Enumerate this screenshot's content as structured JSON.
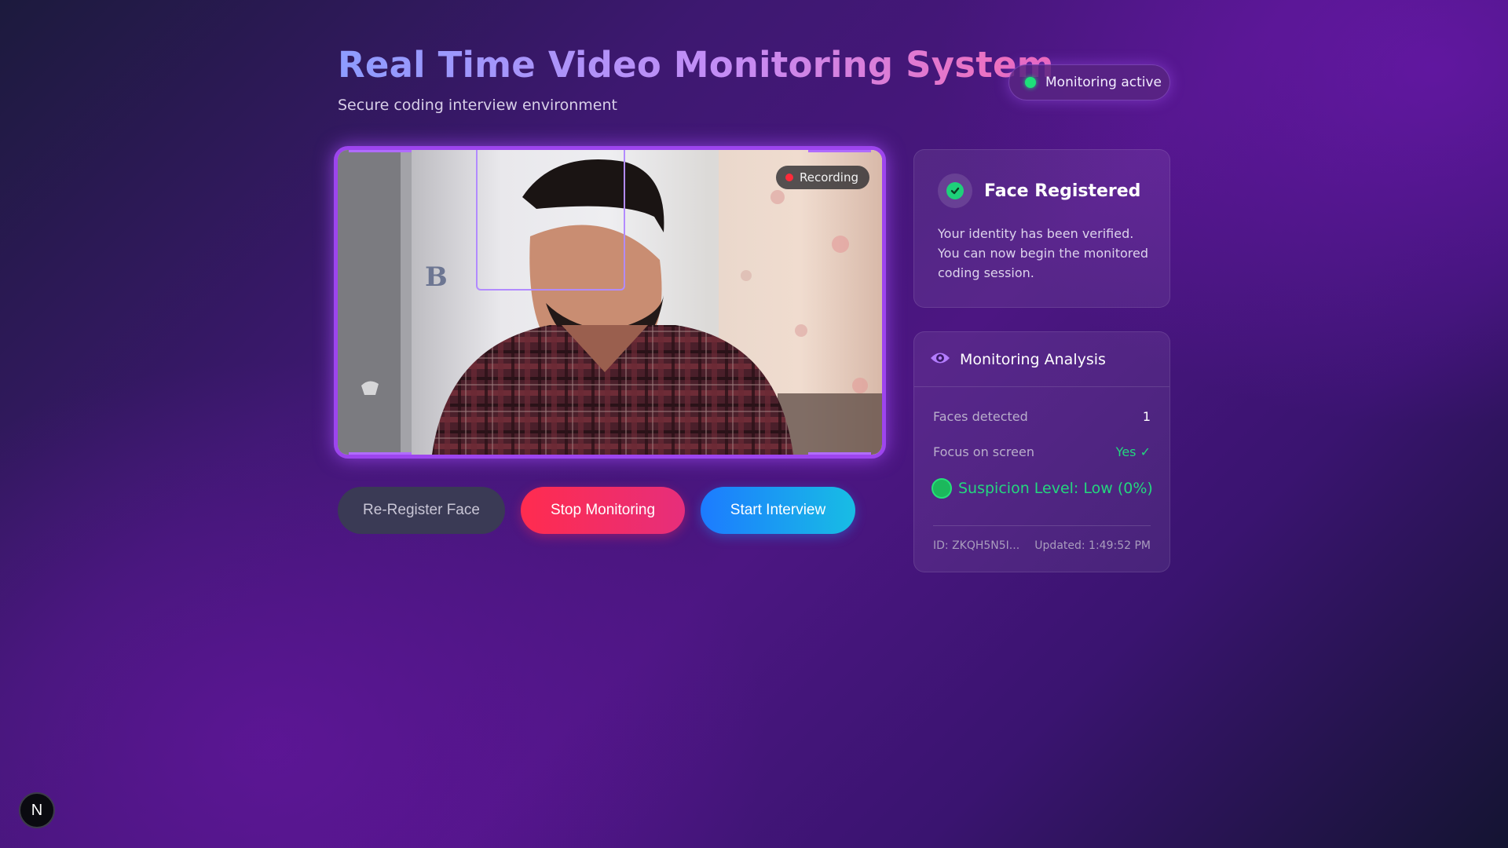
{
  "header": {
    "title": "Real Time Video Monitoring System",
    "subtitle": "Secure coding interview environment"
  },
  "status": {
    "label": "Monitoring active",
    "color": "#1ee07a"
  },
  "video": {
    "recording_label": "Recording",
    "recording_color": "#ff2b3a",
    "background_letter": "B"
  },
  "buttons": {
    "reregister": "Re-Register Face",
    "stop": "Stop Monitoring",
    "start": "Start Interview"
  },
  "face_card": {
    "title": "Face Registered",
    "text": "Your identity has been verified. You can now begin the monitored coding session.",
    "icon": "check-circle-icon"
  },
  "monitoring": {
    "title": "Monitoring Analysis",
    "icon": "eye-icon",
    "rows": [
      {
        "label": "Faces detected",
        "value": "1"
      },
      {
        "label": "Focus on screen",
        "value": "Yes ✓"
      }
    ],
    "suspicion": "Suspicion Level: Low (0%)",
    "id": "ID: ZKQH5N5I...",
    "updated": "Updated: 1:49:52 PM"
  },
  "badge": {
    "letter": "N"
  },
  "colors": {
    "accent": "#9d45ee",
    "stop": "#ff2c4f",
    "start": "#1c7bff",
    "success": "#23d77e"
  }
}
